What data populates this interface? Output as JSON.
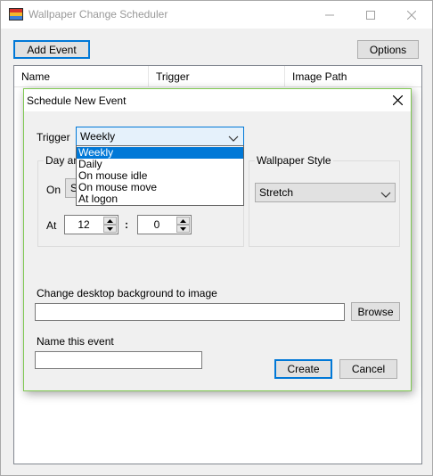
{
  "app": {
    "title": "Wallpaper Change Scheduler"
  },
  "toolbar": {
    "add_event_label": "Add Event",
    "options_label": "Options"
  },
  "events_list": {
    "columns": [
      "Name",
      "Trigger",
      "Image Path"
    ],
    "rows": []
  },
  "dialog": {
    "title": "Schedule New Event",
    "trigger": {
      "label": "Trigger",
      "value": "Weekly",
      "options": [
        "Weekly",
        "Daily",
        "On mouse idle",
        "On mouse move",
        "At logon"
      ],
      "selected_index": 0
    },
    "day_group": {
      "label": "Day and Time",
      "on_label": "On",
      "on_value": "S",
      "at_label": "At",
      "hour": "12",
      "separator": ":",
      "minute": "0"
    },
    "style_group": {
      "label": "Wallpaper Style",
      "value": "Stretch"
    },
    "background": {
      "label": "Change desktop background to image",
      "path_value": "",
      "browse_label": "Browse"
    },
    "name": {
      "label": "Name this event",
      "value": ""
    },
    "create_label": "Create",
    "cancel_label": "Cancel"
  },
  "colors": {
    "accent": "#0078d7",
    "dialog_border": "#7ec850",
    "button_face": "#e1e1e1",
    "window_bg": "#f0f0f0"
  },
  "icons": [
    "app-icon",
    "minimize-icon",
    "maximize-icon",
    "close-icon",
    "chevron-down-icon",
    "spin-up-icon",
    "spin-down-icon"
  ]
}
